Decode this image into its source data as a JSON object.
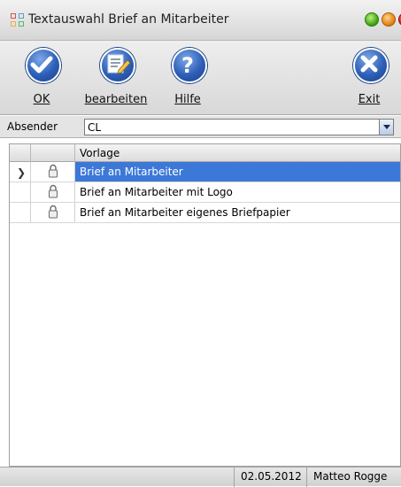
{
  "window": {
    "title": "Textauswahl Brief an Mitarbeiter",
    "controls": [
      "minimize",
      "maximize",
      "close"
    ]
  },
  "toolbar": {
    "ok_label": "OK",
    "edit_label": "bearbeiten",
    "help_label": "Hilfe",
    "exit_label": "Exit"
  },
  "absender": {
    "label": "Absender",
    "value": "CL"
  },
  "table": {
    "columns": [
      "",
      "",
      "Vorlage"
    ],
    "rows": [
      {
        "name": "Brief an Mitarbeiter",
        "selected": true
      },
      {
        "name": "Brief an Mitarbeiter mit Logo",
        "selected": false
      },
      {
        "name": "Brief an Mitarbeiter eigenes Briefpapier",
        "selected": false
      }
    ]
  },
  "status": {
    "date": "02.05.2012",
    "user": "Matteo Rogge"
  },
  "colors": {
    "selection": "#3c78d8",
    "toolbar_icon": "#2d5fb8"
  }
}
